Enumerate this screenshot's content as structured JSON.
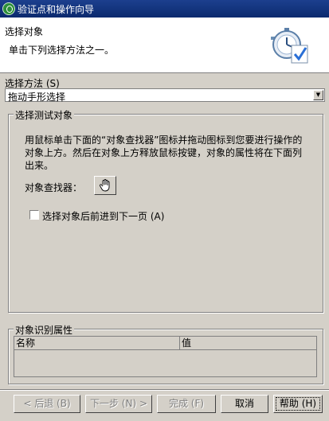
{
  "window": {
    "title": "验证点和操作向导"
  },
  "header": {
    "title": "选择对象",
    "subtitle": "单击下列选择方法之一。"
  },
  "method": {
    "label": "选择方法 (S)",
    "selected": "拖动手形选择"
  },
  "select_test_object": {
    "group_title": "选择测试对象",
    "instructions": "用鼠标单击下面的“对象查找器”图标并拖动图标到您要进行操作的对象上方。然后在对象上方释放鼠标按键，对象的属性将在下面列出来。",
    "finder_label": "对象查找器：",
    "next_page_checkbox": {
      "label": "选择对象后前进到下一页 (A)",
      "checked": false
    }
  },
  "recognition_properties": {
    "group_title": "对象识别属性",
    "columns": [
      "名称",
      "值"
    ]
  },
  "buttons": {
    "back": "< 后退 (B)",
    "next": "下一步 (N) >",
    "finish": "完成 (F)",
    "cancel": "取消",
    "help": "帮助 (H)"
  },
  "icons": {
    "app": "app-wizard-icon",
    "header": "stopwatch-checkmark-icon",
    "finder": "hand-icon",
    "dropdown": "chevron-down-icon"
  }
}
